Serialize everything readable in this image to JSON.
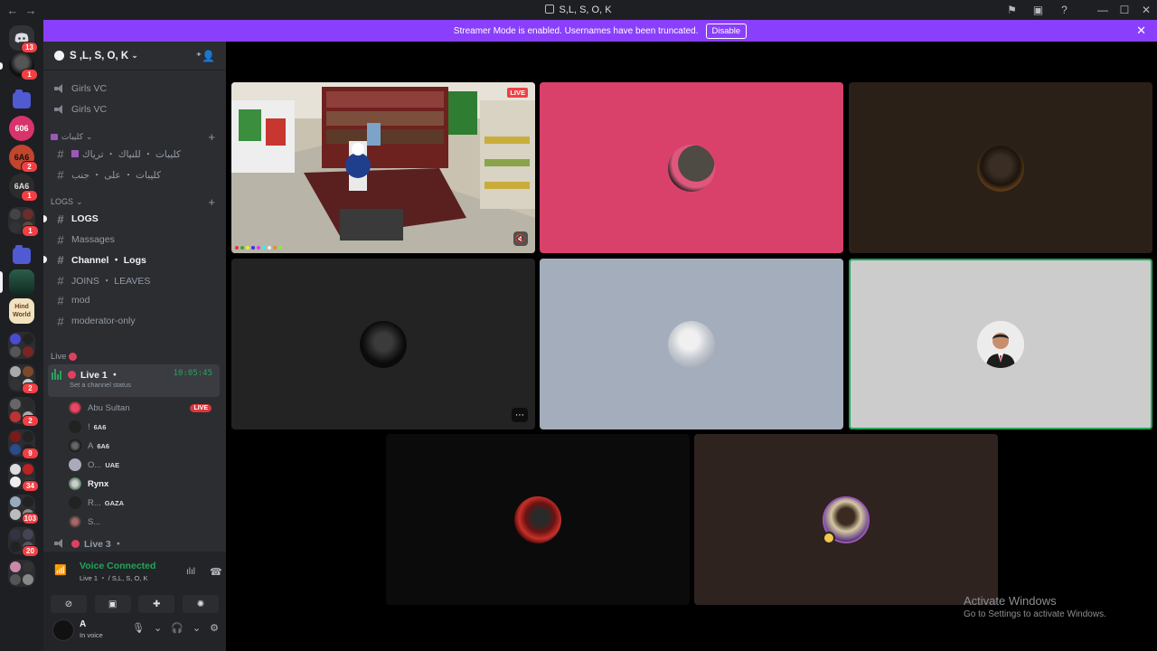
{
  "window": {
    "title": "S,L, S, O, K",
    "nav_back": "←",
    "nav_forward": "→"
  },
  "banner": {
    "message": "Streamer Mode is enabled. Usernames have been truncated.",
    "disable_label": "Disable",
    "close": "✕"
  },
  "rail": {
    "badges": [
      "13",
      "1",
      "2",
      "1",
      "1",
      "2",
      "2",
      "9",
      "34",
      "103",
      "20"
    ]
  },
  "server": {
    "name": "S ,L, S, O, K"
  },
  "channels": {
    "voice_top": [
      "Girls VC",
      "Girls VC"
    ],
    "category_arabic": "كليبات",
    "arabic_channels": [
      "كليبات ・ للنياك ・ ترياك",
      "كليبات ・ على ・ جنب"
    ],
    "logs_category": "LOGS",
    "logs_channels": [
      {
        "name": "LOGS",
        "bold": true
      },
      {
        "name": "Massages",
        "bold": false
      },
      {
        "name": "Channel ・ Logs",
        "bold": true
      },
      {
        "name": "JOINS ・ LEAVES",
        "bold": false
      },
      {
        "name": "mod",
        "bold": false
      },
      {
        "name": "moderator-only",
        "bold": false
      }
    ],
    "live_category": "Live",
    "live1": {
      "name": "Live 1 ・",
      "status": "Set a channel status",
      "timer": "10:05:45"
    },
    "live3": "Live 3 ・",
    "members": [
      {
        "name": "Abu Sultan",
        "tag": "",
        "live": "LIVE"
      },
      {
        "name": "!",
        "tag": "6A6",
        "live": ""
      },
      {
        "name": "A",
        "tag": "6A6",
        "live": ""
      },
      {
        "name": "O...",
        "tag": "UAE",
        "live": ""
      },
      {
        "name": "Rynx",
        "tag": "",
        "live": ""
      },
      {
        "name": "R...",
        "tag": "GAZA",
        "live": ""
      },
      {
        "name": "S...",
        "tag": "",
        "live": ""
      }
    ]
  },
  "voice_panel": {
    "status": "Voice Connected",
    "sub": "Live 1 ・ / S,L, S, O, K"
  },
  "user": {
    "name": "A",
    "status": "In voice"
  },
  "stage": {
    "live_label": "LIVE",
    "tiles": [
      {
        "bg": "#3a2a22",
        "kind": "stream"
      },
      {
        "bg": "#d9416b",
        "kind": "avatar"
      },
      {
        "bg": "#2a2018",
        "kind": "avatar"
      },
      {
        "bg": "#232323",
        "kind": "avatar"
      },
      {
        "bg": "#a3adbb",
        "kind": "avatar"
      },
      {
        "bg": "#cccccc",
        "kind": "avatar",
        "speaking": true
      },
      {
        "bg": "#0b0b0b",
        "kind": "avatar"
      },
      {
        "bg": "#2f2320",
        "kind": "avatar"
      }
    ]
  },
  "activate": {
    "line1": "Activate Windows",
    "line2": "Go to Settings to activate Windows."
  }
}
